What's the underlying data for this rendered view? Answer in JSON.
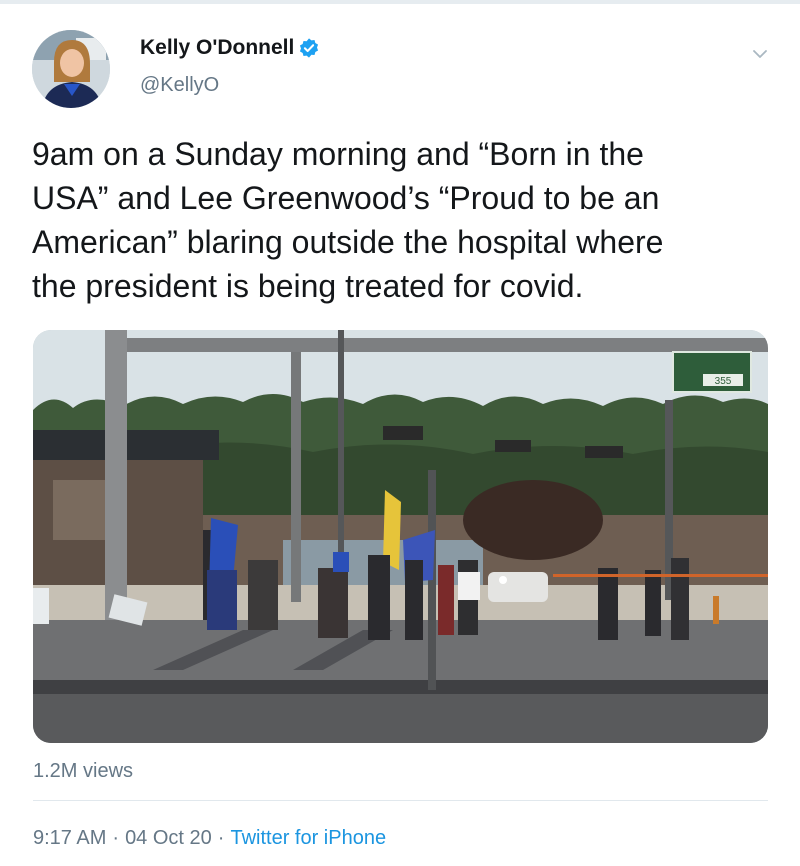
{
  "tweet": {
    "author": {
      "display_name": "Kelly O'Donnell",
      "handle": "@KellyO",
      "verified_icon": "verified-badge-icon"
    },
    "menu_icon": "chevron-down-icon",
    "text_lines": [
      "9am on a Sunday morning and “Born in the",
      "USA” and Lee Greenwood’s “Proud to be an",
      "American” blaring outside the hospital where",
      "the president is being treated for covid."
    ],
    "media": {
      "type": "video-thumbnail",
      "road_sign": "355"
    },
    "views": "1.2M views",
    "time": "9:17 AM",
    "separator": "·",
    "date": "04 Oct 20",
    "source": "Twitter for iPhone"
  },
  "colors": {
    "text": "#14171a",
    "secondary": "#657786",
    "accent": "#1b95e0",
    "verified": "#1da1f2",
    "divider": "#e1e8ed"
  }
}
